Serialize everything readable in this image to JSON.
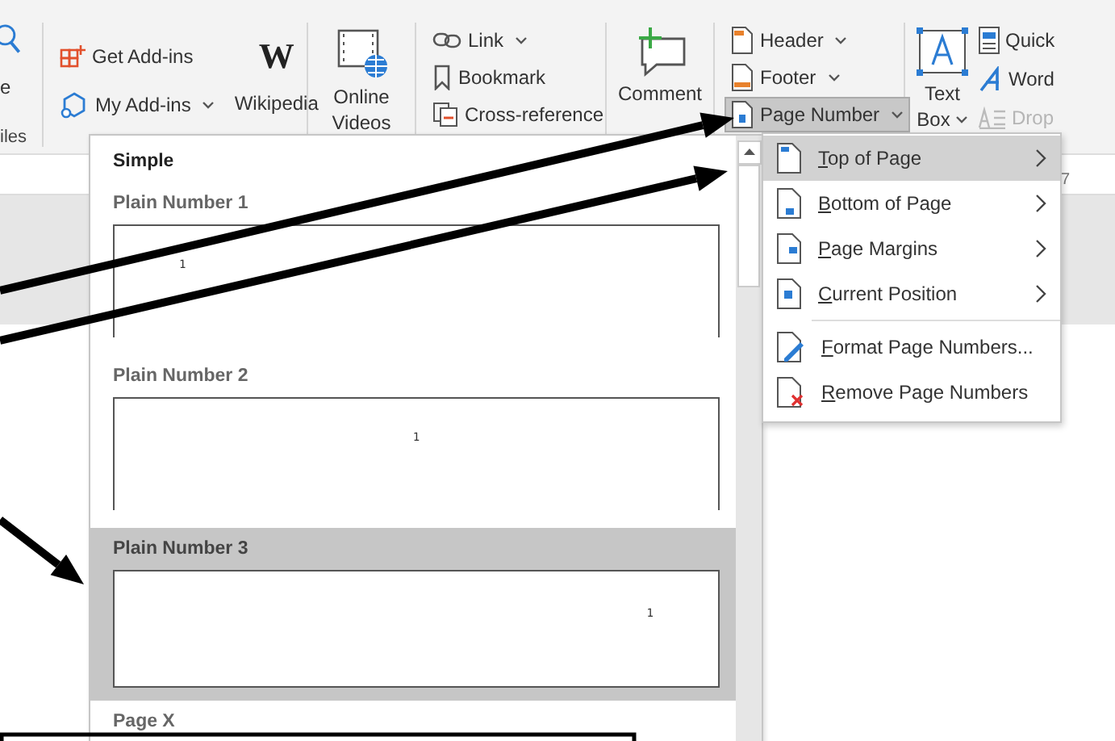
{
  "ribbon": {
    "partial_group": {
      "label_fragment": "e",
      "group_label": "iles"
    },
    "groups": [
      {
        "kind": "addins",
        "items": [
          {
            "label": "Get Add-ins",
            "caret": false
          },
          {
            "label": "My Add-ins",
            "caret": true
          }
        ],
        "big": {
          "label": "Wikipedia",
          "glyph": "W"
        }
      },
      {
        "kind": "big",
        "big": {
          "label": "Online Videos"
        }
      },
      {
        "kind": "small",
        "items": [
          {
            "label": "Link",
            "caret": true
          },
          {
            "label": "Bookmark",
            "caret": false
          },
          {
            "label": "Cross-reference",
            "caret": false
          }
        ]
      },
      {
        "kind": "big",
        "big": {
          "label": "Comment"
        }
      },
      {
        "kind": "small",
        "items": [
          {
            "label": "Header",
            "caret": true,
            "selected": false
          },
          {
            "label": "Footer",
            "caret": true,
            "selected": false
          },
          {
            "label": "Page Number",
            "caret": true,
            "selected": true
          }
        ]
      },
      {
        "kind": "text",
        "big": {
          "label": "Text",
          "label2": "Box"
        },
        "items": [
          {
            "label": "Quick",
            "disabled": false
          },
          {
            "label": "Word",
            "disabled": false
          },
          {
            "label": "Drop",
            "disabled": true
          }
        ]
      }
    ]
  },
  "ruler": {
    "mark": "7"
  },
  "gallery": {
    "section": "Simple",
    "items": [
      {
        "label": "Plain Number 1",
        "selected": false,
        "number": "1",
        "kind": "open"
      },
      {
        "label": "Plain Number 2",
        "selected": false,
        "number": "1",
        "kind": "open"
      },
      {
        "label": "Plain Number 3",
        "selected": true,
        "number": "1",
        "kind": "closed"
      },
      {
        "label": "Page X",
        "selected": false,
        "kind": "label"
      }
    ]
  },
  "menu": {
    "items": [
      {
        "label": "Top of Page",
        "selected": true,
        "submenu": true
      },
      {
        "label": "Bottom of Page",
        "selected": false,
        "submenu": true
      },
      {
        "label": "Page Margins",
        "selected": false,
        "submenu": true
      },
      {
        "label": "Current Position",
        "selected": false,
        "submenu": true
      },
      {
        "label": "Format Page Numbers...",
        "selected": false,
        "submenu": false,
        "separator_before": true
      },
      {
        "label": "Remove Page Numbers",
        "selected": false,
        "submenu": false
      }
    ]
  }
}
